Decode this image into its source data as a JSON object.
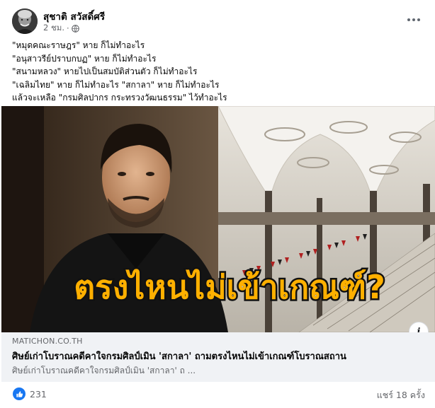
{
  "post": {
    "author": "สุชาติ สวัสดิ์ศรี",
    "time": "2 ชม.",
    "separator": "·",
    "text_lines": [
      "\"หมุดคณะราษฎร\" หาย ก็ไม่ทำอะไร",
      "\"อนุสาวรีย์ปราบกบฏ\" หาย ก็ไม่ทำอะไร",
      "\"สนามหลวง\" หายไปเป็นสมบัติส่วนตัว ก็ไม่ทำอะไร",
      "\"เฉลิมไทย\" หาย ก็ไม่ทำอะไร  \"สกาลา\" หาย ก็ไม่ทำอะไร",
      "แล้วจะเหลือ \"กรมศิลปากร กระทรวงวัฒนธรรม\" ไว้ทำอะไร"
    ]
  },
  "media": {
    "overlay_text": "ตรงไหนไม่เข้าเกณฑ์?",
    "info_label": "i"
  },
  "link": {
    "domain": "MATICHON.CO.TH",
    "title": "ศิษย์เก่าโบราณคดีคาใจกรมศิลป์เมิน 'สกาลา' ถามตรงไหนไม่เข้าเกณฑ์โบราณสถาน",
    "description": "ศิษย์เก่าโบราณคดีคาใจกรมศิลป์เมิน 'สกาลา' ถ ..."
  },
  "footer": {
    "reaction_count": "231",
    "shares": "แชร์ 18 ครั้ง"
  },
  "colors": {
    "overlay_fill": "#ffb000",
    "overlay_stroke": "#111111",
    "like_blue": "#1877f2",
    "link_bg": "#f0f2f5"
  },
  "icons": {
    "globe": "globe-icon",
    "more": "more-options-icon",
    "like": "like-icon",
    "info": "info-icon"
  }
}
